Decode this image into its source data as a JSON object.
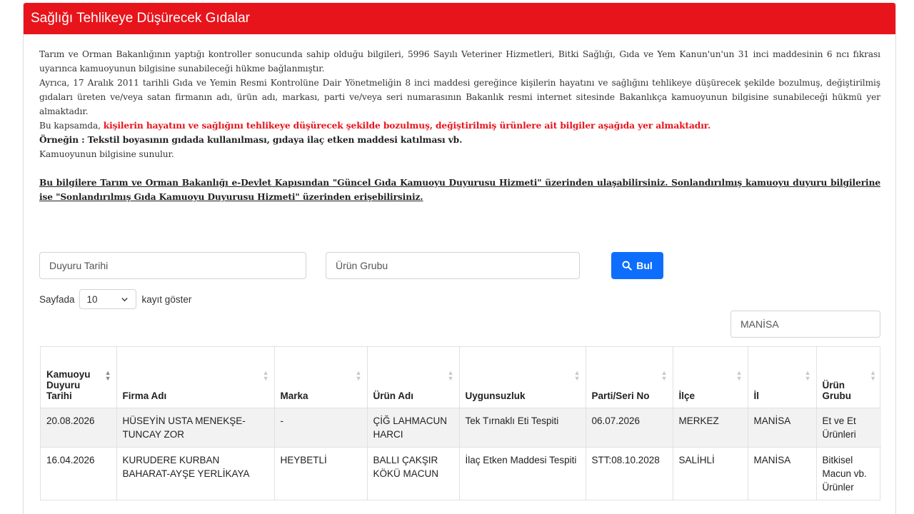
{
  "header": {
    "title": "Sağlığı Tehlikeye Düşürecek Gıdalar"
  },
  "intro": {
    "p1": "Tarım ve Orman Bakanlığının yaptığı kontroller sonucunda sahip olduğu bilgileri, 5996 Sayılı Veteriner Hizmetleri, Bitki Sağlığı, Gıda ve Yem Kanun'un'un 31 inci maddesinin 6 ncı fıkrası uyarınca kamuoyunun bilgisine sunabileceği hükme bağlanmıştır.",
    "p2": "Ayrıca, 17 Aralık 2011 tarihli Gıda ve Yemin Resmi Kontrolüne Dair Yönetmeliğin 8 inci maddesi gereğince kişilerin hayatını ve sağlığını tehlikeye düşürecek şekilde bozulmuş, değiştirilmiş gıdaları üreten ve/veya satan firmanın adı, ürün adı, markası, parti ve/veya seri numarasının Bakanlık resmi internet sitesinde Bakanlıkça kamuoyunun bilgisine sunabileceği hükmü yer almaktadır.",
    "p3_prefix": "Bu kapsamda, ",
    "p3_red": "kişilerin hayatını ve sağlığını tehlikeye düşürecek şekilde bozulmuş, değiştirilmiş ürünlere ait bilgiler aşağıda yer almaktadır.",
    "p4": "Örneğin : Tekstil boyasının gıdada kullanılması, gıdaya ilaç etken maddesi katılması vb.",
    "p5": "Kamuoyunun bilgisine sunulur.",
    "p6": "Bu bilgilere Tarım ve Orman Bakanlığı e-Devlet Kapısından \"Güncel Gıda Kamuoyu Duyurusu Hizmeti\" üzerinden ulaşabilirsiniz. Sonlandırılmış kamuoyu duyuru bilgilerine ise \"Sonlandırılmış Gıda Kamuoyu Duyurusu Hizmeti\" üzerinden erişebilirsiniz."
  },
  "filters": {
    "date_placeholder": "Duyuru Tarihi",
    "group_placeholder": "Ürün Grubu",
    "find_label": "Bul",
    "search_value": "MANİSA"
  },
  "perpage": {
    "prefix": "Sayfada",
    "value": "10",
    "suffix": "kayıt göster"
  },
  "table": {
    "columns": [
      "Kamuoyu Duyuru Tarihi",
      "Firma Adı",
      "Marka",
      "Ürün Adı",
      "Uygunsuzluk",
      "Parti/Seri No",
      "İlçe",
      "İl",
      "Ürün Grubu"
    ],
    "rows": [
      [
        "20.08.2026",
        "HÜSEYİN USTA MENEKŞE-TUNCAY ZOR",
        "-",
        "ÇİĞ LAHMACUN HARCI",
        "Tek Tırnaklı Eti Tespiti",
        "06.07.2026",
        "MERKEZ",
        "MANİSA",
        "Et ve Et Ürünleri"
      ],
      [
        "16.04.2026",
        "KURUDERE KURBAN BAHARAT-AYŞE YERLİKAYA",
        "HEYBETLİ",
        "BALLI ÇAKŞIR KÖKÜ MACUN",
        "İlaç Etken Maddesi Tespiti",
        "STT:08.10.2028",
        "SALİHLİ",
        "MANİSA",
        "Bitkisel Macun vb. Ürünler"
      ]
    ]
  },
  "colors": {
    "header_red": "#e8141b",
    "button_blue": "#0d6efd",
    "stripe": "#f2f2f2"
  },
  "icons": {
    "find": "search-icon",
    "select": "chevron-down-icon",
    "sort": "sort-icon"
  }
}
